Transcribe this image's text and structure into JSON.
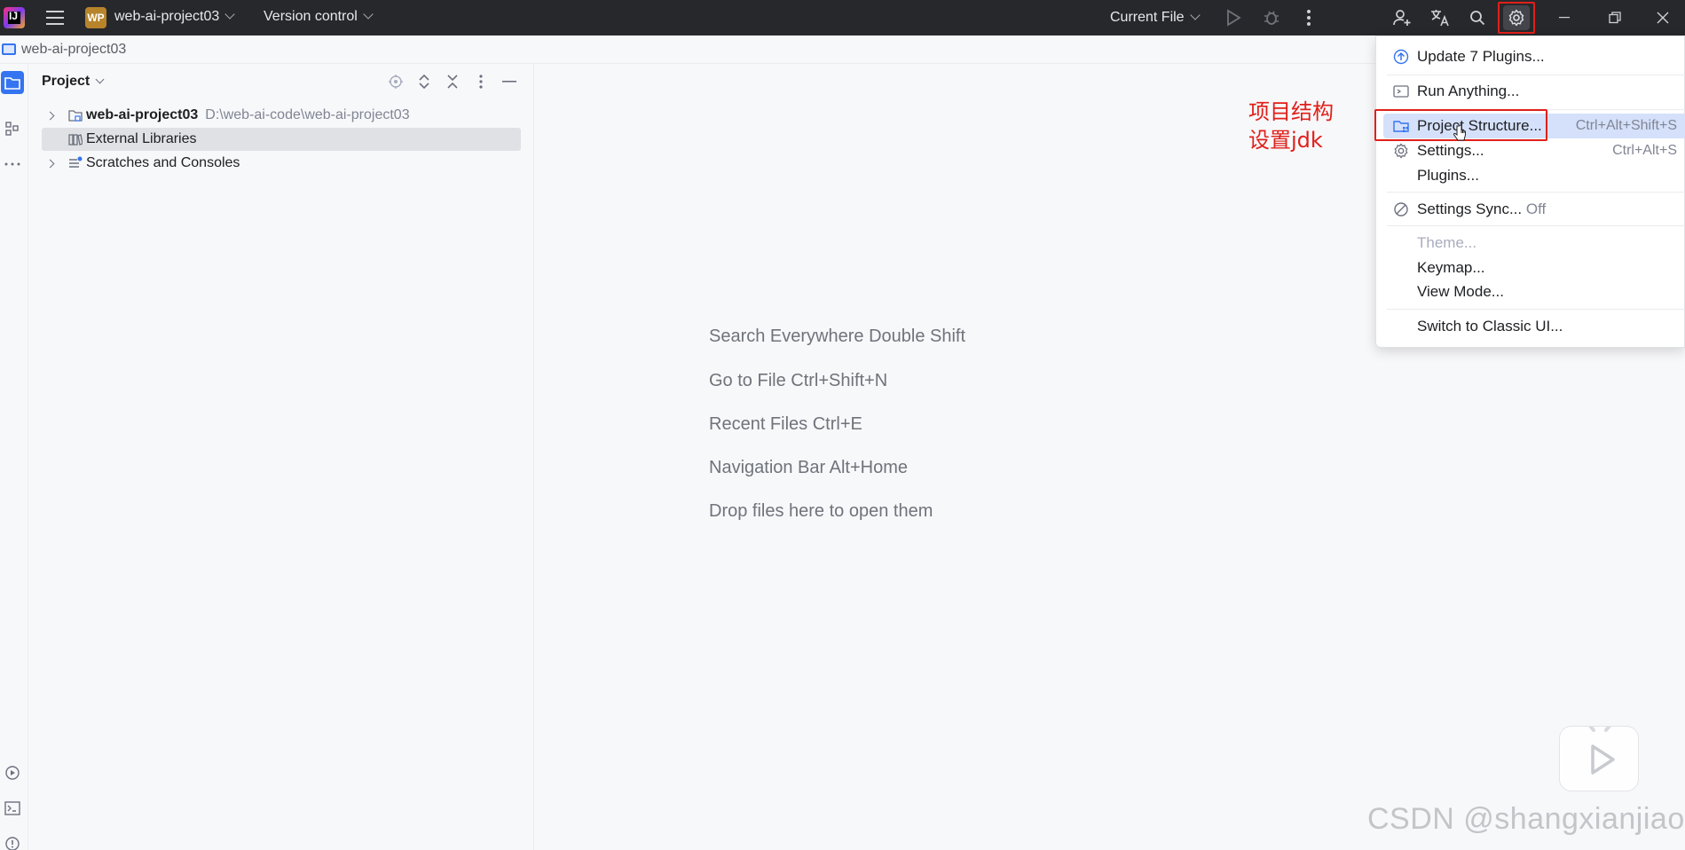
{
  "titlebar": {
    "app_logo_text": "IJ",
    "project_badge": "WP",
    "project_name": "web-ai-project03",
    "version_control": "Version control",
    "run_config": "Current File"
  },
  "breadcrumb": {
    "project": "web-ai-project03"
  },
  "panel": {
    "title": "Project",
    "tree": [
      {
        "label": "web-ai-project03",
        "path": "D:\\web-ai-code\\web-ai-project03"
      },
      {
        "label": "External Libraries"
      },
      {
        "label": "Scratches and Consoles"
      }
    ]
  },
  "editor": {
    "hints": [
      "Search Everywhere Double Shift",
      "Go to File Ctrl+Shift+N",
      "Recent Files Ctrl+E",
      "Navigation Bar Alt+Home",
      "Drop files here to open them"
    ]
  },
  "annotation": {
    "line1": "项目结构",
    "line2": "设置jdk"
  },
  "menu": {
    "items": [
      {
        "label": "Update 7 Plugins...",
        "icon": "update-icon"
      },
      {
        "label": "Run Anything...",
        "icon": "run-anything-icon"
      },
      {
        "label": "Project Structure...",
        "shortcut": "Ctrl+Alt+Shift+S",
        "icon": "project-structure-icon"
      },
      {
        "label": "Settings...",
        "shortcut": "Ctrl+Alt+S",
        "icon": "gear-icon"
      },
      {
        "label": "Plugins..."
      },
      {
        "label": "Settings Sync...",
        "suffix": "Off",
        "icon": "sync-off-icon"
      },
      {
        "label": "Theme..."
      },
      {
        "label": "Keymap..."
      },
      {
        "label": "View Mode..."
      },
      {
        "label": "Switch to Classic UI..."
      }
    ]
  },
  "watermark": "CSDN @shangxianjiao",
  "colors": {
    "accent": "#3574f0",
    "annotation_red": "#e0201a",
    "titlebar_bg": "#27282c",
    "selection": "#d5e1fb"
  }
}
